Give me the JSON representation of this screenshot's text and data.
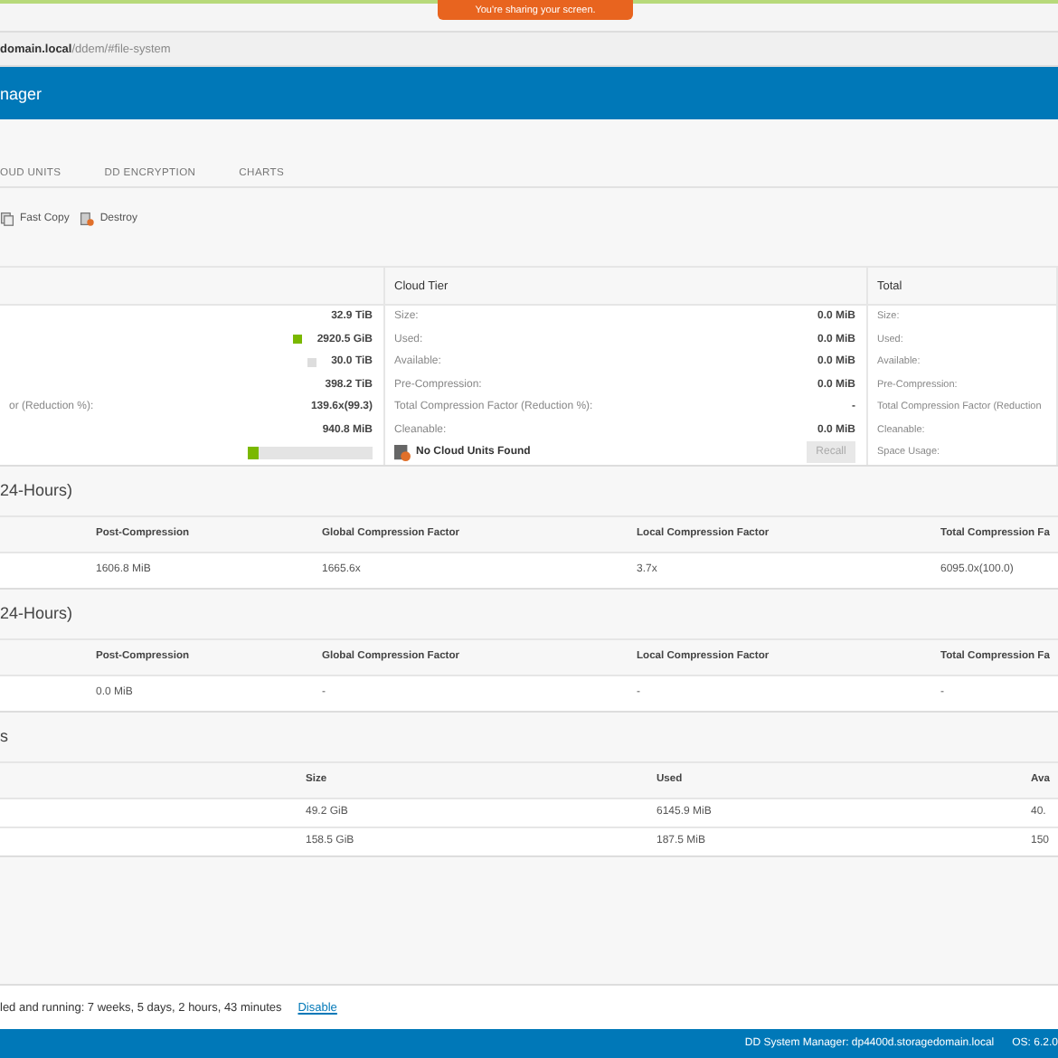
{
  "screen_share_banner": "You're sharing your screen.",
  "address_bar": {
    "host": "domain.local",
    "path": "/ddem/#file-system"
  },
  "header": {
    "title": "nager"
  },
  "tabs": [
    {
      "label": "OUD UNITS",
      "selected": false
    },
    {
      "label": "DD ENCRYPTION",
      "selected": false
    },
    {
      "label": "CHARTS",
      "selected": false
    }
  ],
  "toolbar": [
    {
      "label": "Fast Copy",
      "kind": "copy"
    },
    {
      "label": "Destroy",
      "kind": "destroy"
    }
  ],
  "active_tier": {
    "rows": [
      {
        "value": "32.9 TiB"
      },
      {
        "value": "2920.5 GiB",
        "color": "#7ab800"
      },
      {
        "value": "30.0 TiB",
        "color": "#dddddd"
      },
      {
        "value": "398.2 TiB"
      },
      {
        "label": "or (Reduction %):",
        "value": "139.6x(99.3)"
      },
      {
        "value": "940.8 MiB"
      }
    ],
    "usage_bar": {
      "level": 0.08
    }
  },
  "cloud_tier": {
    "title": "Cloud Tier",
    "rows": [
      {
        "label": "Size:",
        "value": "0.0 MiB"
      },
      {
        "label": "Used:",
        "value": "0.0 MiB"
      },
      {
        "label": "Available:",
        "value": "0.0 MiB"
      },
      {
        "label": "Pre-Compression:",
        "value": "0.0 MiB"
      },
      {
        "label": "Total Compression Factor (Reduction %):",
        "value": "-"
      },
      {
        "label": "Cleanable:",
        "value": "0.0 MiB"
      }
    ],
    "notice": "No Cloud Units Found",
    "recall_button": {
      "label": "Recall",
      "disabled": true
    }
  },
  "total": {
    "title": "Total",
    "rows": [
      "Size:",
      "Used:",
      "Available:",
      "Pre-Compression:",
      "Total Compression Factor (Reduction",
      "Cleanable:",
      "Space Usage:"
    ]
  },
  "compression_sections": [
    {
      "title": "24-Hours)",
      "columns": [
        "Post-Compression",
        "Global Compression Factor",
        "Local Compression Factor",
        "Total Compression Fa"
      ],
      "rows": [
        [
          "1606.8 MiB",
          "1665.6x",
          "3.7x",
          "6095.0x(100.0)"
        ]
      ]
    },
    {
      "title": "24-Hours)",
      "columns": [
        "Post-Compression",
        "Global Compression Factor",
        "Local Compression Factor",
        "Total Compression Fa"
      ],
      "rows": [
        [
          "0.0 MiB",
          "-",
          "-",
          "-"
        ]
      ]
    }
  ],
  "space_section": {
    "title": "s",
    "columns": [
      "Size",
      "Used",
      "Ava"
    ],
    "rows": [
      [
        "49.2 GiB",
        "6145.9 MiB",
        "40."
      ],
      [
        "158.5 GiB",
        "187.5 MiB",
        "150"
      ]
    ]
  },
  "status": {
    "text": "led and running: 7 weeks, 5 days, 2 hours, 43 minutes",
    "link": "Disable"
  },
  "footer": {
    "system": "DD System Manager: dp4400d.storagedomain.local",
    "os": "OS: 6.2.0"
  }
}
